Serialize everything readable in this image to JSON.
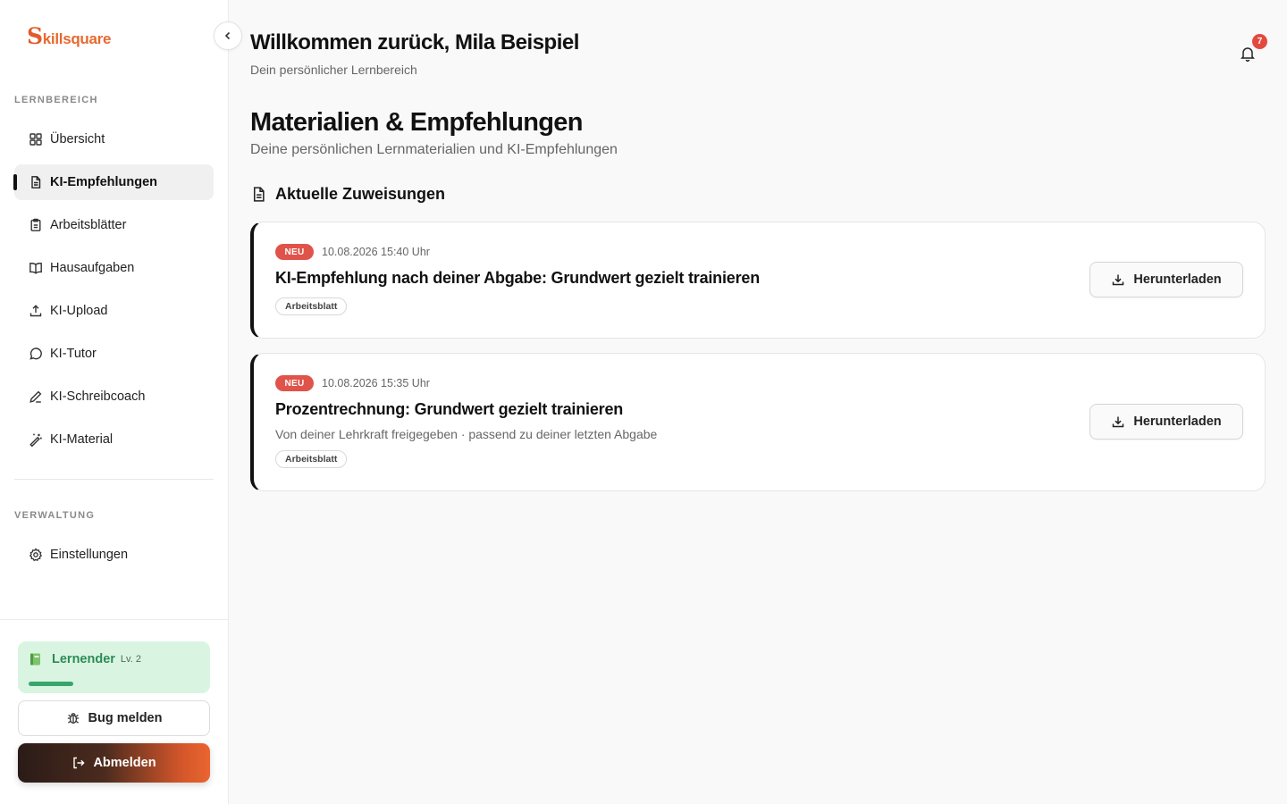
{
  "brand": {
    "first_letter": "S",
    "rest": "killsquare",
    "color": "#e8692f"
  },
  "sidebar": {
    "section_learning": "LERNBEREICH",
    "items": [
      {
        "label": "Übersicht",
        "icon": "grid-icon"
      },
      {
        "label": "KI-Empfehlungen",
        "icon": "document-icon",
        "active": true
      },
      {
        "label": "Arbeitsblätter",
        "icon": "clipboard-icon"
      },
      {
        "label": "Hausaufgaben",
        "icon": "book-open-icon"
      },
      {
        "label": "KI-Upload",
        "icon": "upload-icon"
      },
      {
        "label": "KI-Tutor",
        "icon": "chat-bubble-icon"
      },
      {
        "label": "KI-Schreibcoach",
        "icon": "pen-icon"
      },
      {
        "label": "KI-Material",
        "icon": "magic-wand-icon"
      }
    ],
    "section_admin": "VERWALTUNG",
    "admin_items": [
      {
        "label": "Einstellungen",
        "icon": "gear-icon"
      }
    ],
    "level": {
      "emoji": "📗",
      "name": "Lernender",
      "level": "Lv. 2",
      "progress": 0.26,
      "color": "#3aa56b"
    },
    "bug_button": "Bug melden",
    "logout_button": "Abmelden"
  },
  "header": {
    "welcome": "Willkommen zurück, Mila Beispiel",
    "subtitle": "Dein persönlicher Lernbereich",
    "notification_count": "7"
  },
  "main": {
    "title": "Materialien & Empfehlungen",
    "subtitle": "Deine persönlichen Lernmaterialien und KI-Empfehlungen",
    "section_title": "Aktuelle Zuweisungen",
    "assignments": [
      {
        "badge": "NEU",
        "date": "10.08.2026 15:40 Uhr",
        "title": "KI-Empfehlung nach deiner Abgabe: Grundwert gezielt trainieren",
        "description": "",
        "tag": "Arbeitsblatt",
        "action": "Herunterladen"
      },
      {
        "badge": "NEU",
        "date": "10.08.2026 15:35 Uhr",
        "title": "Prozentrechnung: Grundwert gezielt trainieren",
        "description": "Von deiner Lehrkraft freigegeben · passend zu deiner letzten Abgabe",
        "tag": "Arbeitsblatt",
        "action": "Herunterladen"
      }
    ]
  }
}
